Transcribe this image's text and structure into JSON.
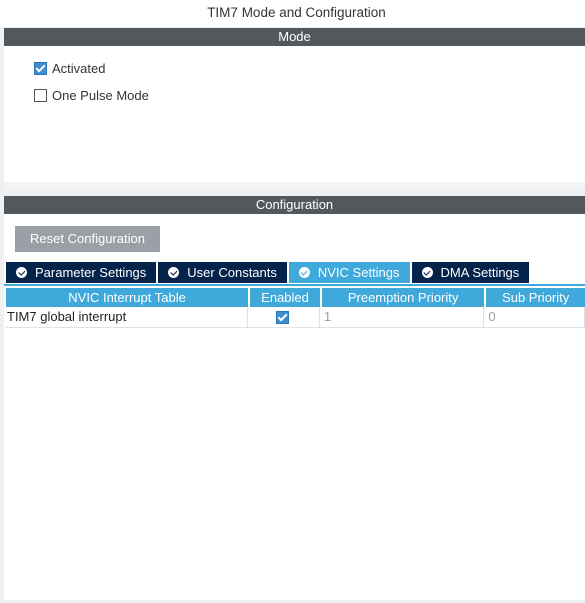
{
  "window": {
    "title": "TIM7 Mode and Configuration"
  },
  "mode": {
    "header": "Mode",
    "options": [
      {
        "label": "Activated",
        "checked": true
      },
      {
        "label": "One Pulse Mode",
        "checked": false
      }
    ]
  },
  "configuration": {
    "header": "Configuration",
    "reset_label": "Reset Configuration",
    "tabs": [
      {
        "label": "Parameter Settings",
        "active": false,
        "icon": "check-circle-icon"
      },
      {
        "label": "User Constants",
        "active": false,
        "icon": "check-circle-icon"
      },
      {
        "label": "NVIC Settings",
        "active": true,
        "icon": "check-circle-icon"
      },
      {
        "label": "DMA Settings",
        "active": false,
        "icon": "check-circle-icon"
      }
    ],
    "nvic_table": {
      "columns": [
        "NVIC Interrupt Table",
        "Enabled",
        "Preemption Priority",
        "Sub Priority"
      ],
      "rows": [
        {
          "name": "TIM7 global interrupt",
          "enabled": true,
          "preemption": "1",
          "sub": "0"
        }
      ]
    }
  },
  "colors": {
    "header_bg": "#53585c",
    "tab_bg": "#03234b",
    "tab_active_bg": "#3fa9dc",
    "checkbox_checked": "#3e8ecf",
    "reset_button_bg": "#9aa0a5"
  }
}
